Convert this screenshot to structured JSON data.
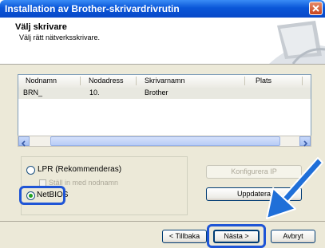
{
  "window": {
    "title": "Installation av Brother-skrivardrivrutin"
  },
  "header": {
    "title": "Välj skrivare",
    "subtitle": "Välj rätt nätverksskrivare."
  },
  "list": {
    "columns": [
      "Nodnamn",
      "Nodadress",
      "Skrivarnamn",
      "Plats"
    ],
    "rows": [
      {
        "node_name": "BRN_",
        "node_address": "10.",
        "printer_name": "Brother",
        "location": ""
      }
    ]
  },
  "options": {
    "lpr_label": "LPR (Rekommenderas)",
    "lpr_selected": false,
    "set_by_nodename_label": "Ställ in med nodnamn",
    "netbios_label": "NetBIOS",
    "netbios_selected": true
  },
  "buttons": {
    "configure_ip": "Konfigurera IP",
    "update": "Uppdatera",
    "back": "< Tillbaka",
    "next": "Nästa >",
    "cancel": "Avbryt"
  },
  "colors": {
    "highlight": "#1f55d6",
    "arrow": "#1f6fd8"
  }
}
